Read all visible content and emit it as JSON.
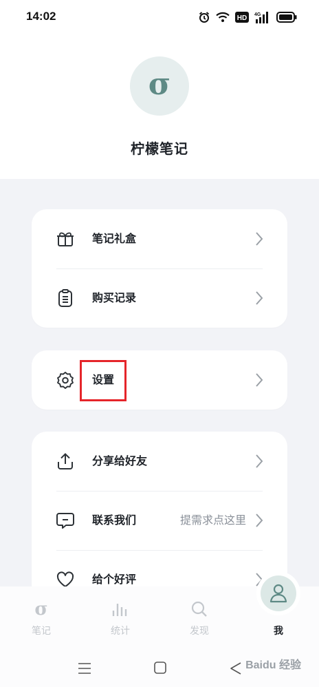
{
  "status_bar": {
    "time": "14:02",
    "icons": [
      "alarm-icon",
      "wifi-icon",
      "hd-icon",
      "signal-4g-icon",
      "battery-icon"
    ],
    "hd_label": "HD",
    "net_label": "4G"
  },
  "app": {
    "logo_glyph": "σ",
    "name": "柠檬笔记"
  },
  "menu_groups": [
    {
      "items": [
        {
          "label": "笔记礼盒",
          "icon": "gift-box-icon"
        },
        {
          "label": "购买记录",
          "icon": "clipboard-list-icon"
        }
      ]
    },
    {
      "items": [
        {
          "label": "设置",
          "icon": "settings-gear-icon"
        }
      ]
    },
    {
      "items": [
        {
          "label": "分享给好友",
          "icon": "share-upload-icon"
        },
        {
          "label": "联系我们",
          "icon": "message-icon",
          "hint": "提需求点这里"
        },
        {
          "label": "给个好评",
          "icon": "heart-icon"
        }
      ]
    }
  ],
  "tabbar": {
    "tabs": [
      {
        "label": "笔记",
        "icon": "notes-sigma-icon",
        "active": false
      },
      {
        "label": "统计",
        "icon": "bar-stats-icon",
        "active": false
      },
      {
        "label": "发现",
        "icon": "search-icon",
        "active": false
      },
      {
        "label": "我",
        "icon": "person-icon",
        "active": true
      }
    ]
  },
  "colors": {
    "accent": "#5e8a85",
    "page_bg": "#f2f3f7",
    "highlight_border": "#e5252a"
  },
  "watermark": "Baidu 经验"
}
